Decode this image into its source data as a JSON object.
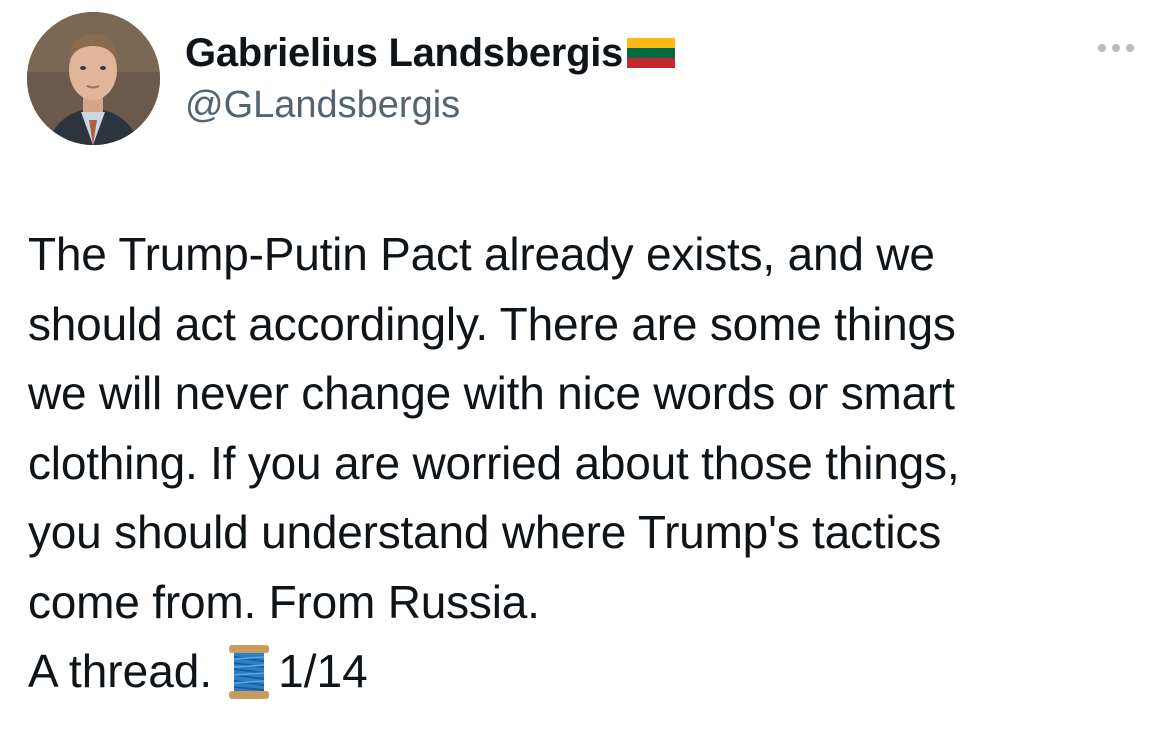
{
  "tweet": {
    "author": {
      "display_name": "Gabrielius Landsbergis",
      "handle": "@GLandsbergis",
      "flag_colors": [
        "#FDB913",
        "#006A44",
        "#C1272D"
      ]
    },
    "body": "The Trump-Putin Pact already exists, and we\nshould act accordingly. There are some things\nwe will never change with nice words or smart\nclothing. If you are worried about those things,\nyou should understand where Trump's tactics\ncome from. From Russia.",
    "thread_label": "A thread.",
    "thread_icon": "spool-of-thread-emoji",
    "thread_counter": "1/14",
    "more_icon": "more-options-icon"
  },
  "colors": {
    "text": "#0f1419",
    "secondary": "#536471",
    "more_dots": "#b5bcc2",
    "background": "#ffffff"
  }
}
